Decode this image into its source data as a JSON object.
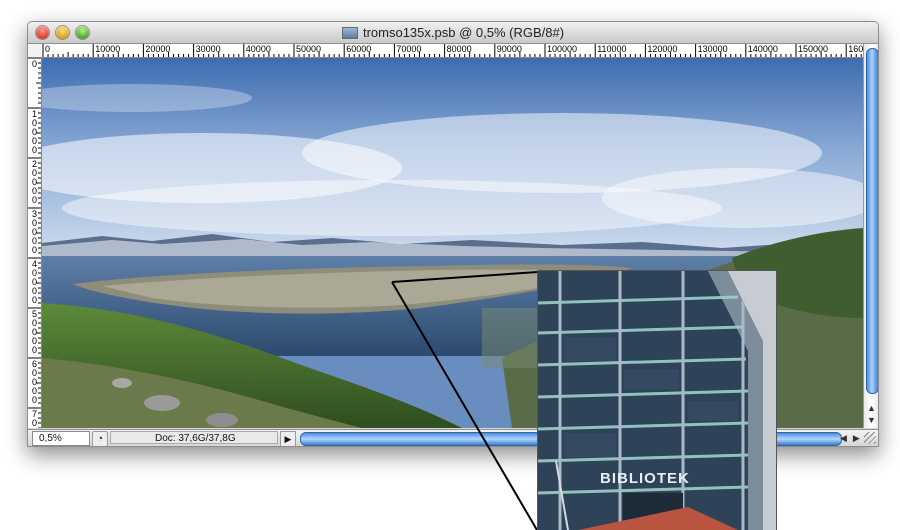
{
  "window": {
    "title": "tromso135x.psb @ 0,5% (RGB/8#)"
  },
  "ruler": {
    "h_labels": [
      "0",
      "10000",
      "20000",
      "30000",
      "40000",
      "50000",
      "60000",
      "70000",
      "80000",
      "90000",
      "100000",
      "110000",
      "120000",
      "130000",
      "140000",
      "150000",
      "160"
    ],
    "v_labels": [
      "0",
      "1 0 0 0 0",
      "2 0 0 0 0",
      "3 0 0 0 0",
      "4 0 0 0 0",
      "5 0 0 0 0",
      "6 0 0 0 0",
      "7 0"
    ]
  },
  "status": {
    "zoom": "0,5%",
    "doc_info": "Doc: 37,6G/37,8G"
  },
  "inset": {
    "sign_text": "BIBLIOTEK"
  },
  "icons": {
    "close": "close-button-icon",
    "minimize": "minimize-button-icon",
    "zoom": "zoom-button-icon"
  },
  "colors": {
    "scrollbar_blue": "#4f8ed9",
    "title_bar": "#d0d0d0"
  }
}
